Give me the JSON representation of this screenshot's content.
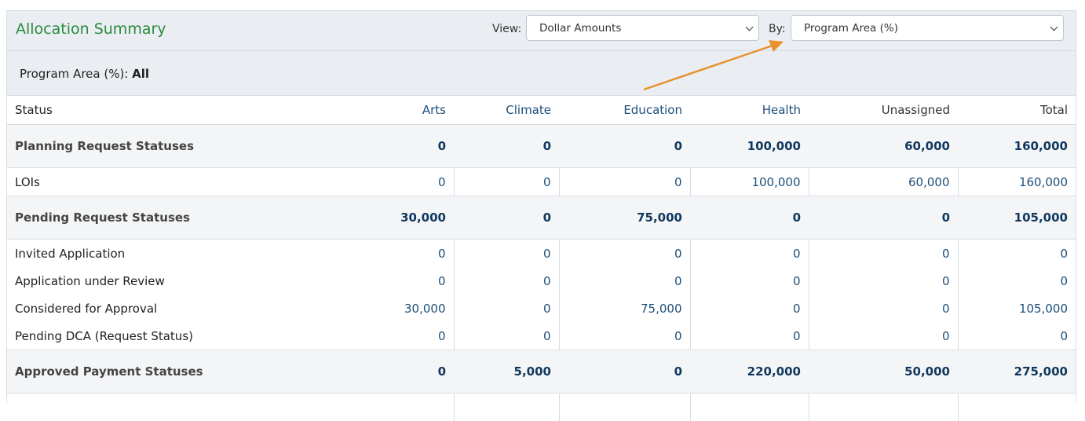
{
  "panel": {
    "title": "Allocation Summary",
    "view_label": "View:",
    "view_value": "Dollar Amounts",
    "by_label": "By:",
    "by_value": "Program Area (%)",
    "filter_label": "Program Area (%):",
    "filter_value": "All"
  },
  "table": {
    "columns": [
      "Status",
      "Arts",
      "Climate",
      "Education",
      "Health",
      "Unassigned",
      "Total"
    ],
    "rows": [
      {
        "type": "group",
        "label": "Planning Request Statuses",
        "values": [
          "0",
          "0",
          "0",
          "100,000",
          "60,000",
          "160,000"
        ]
      },
      {
        "type": "detail",
        "label": "LOIs",
        "values": [
          "0",
          "0",
          "0",
          "100,000",
          "60,000",
          "160,000"
        ],
        "last": true
      },
      {
        "type": "group",
        "label": "Pending Request Statuses",
        "values": [
          "30,000",
          "0",
          "75,000",
          "0",
          "0",
          "105,000"
        ]
      },
      {
        "type": "detail",
        "label": "Invited Application",
        "values": [
          "0",
          "0",
          "0",
          "0",
          "0",
          "0"
        ]
      },
      {
        "type": "detail",
        "label": "Application under Review",
        "values": [
          "0",
          "0",
          "0",
          "0",
          "0",
          "0"
        ]
      },
      {
        "type": "detail",
        "label": "Considered for Approval",
        "values": [
          "30,000",
          "0",
          "75,000",
          "0",
          "0",
          "105,000"
        ]
      },
      {
        "type": "detail",
        "label": "Pending DCA (Request Status)",
        "values": [
          "0",
          "0",
          "0",
          "0",
          "0",
          "0"
        ],
        "last": true
      },
      {
        "type": "group",
        "label": "Approved Payment Statuses",
        "values": [
          "0",
          "5,000",
          "0",
          "220,000",
          "50,000",
          "275,000"
        ]
      },
      {
        "type": "detail",
        "label": "",
        "values": [
          "",
          "",
          "",
          "",
          "",
          ""
        ]
      }
    ]
  },
  "colors": {
    "title_green": "#2a8a3e",
    "value_blue": "#1d4f7a",
    "arrow_orange": "#e8912d"
  }
}
